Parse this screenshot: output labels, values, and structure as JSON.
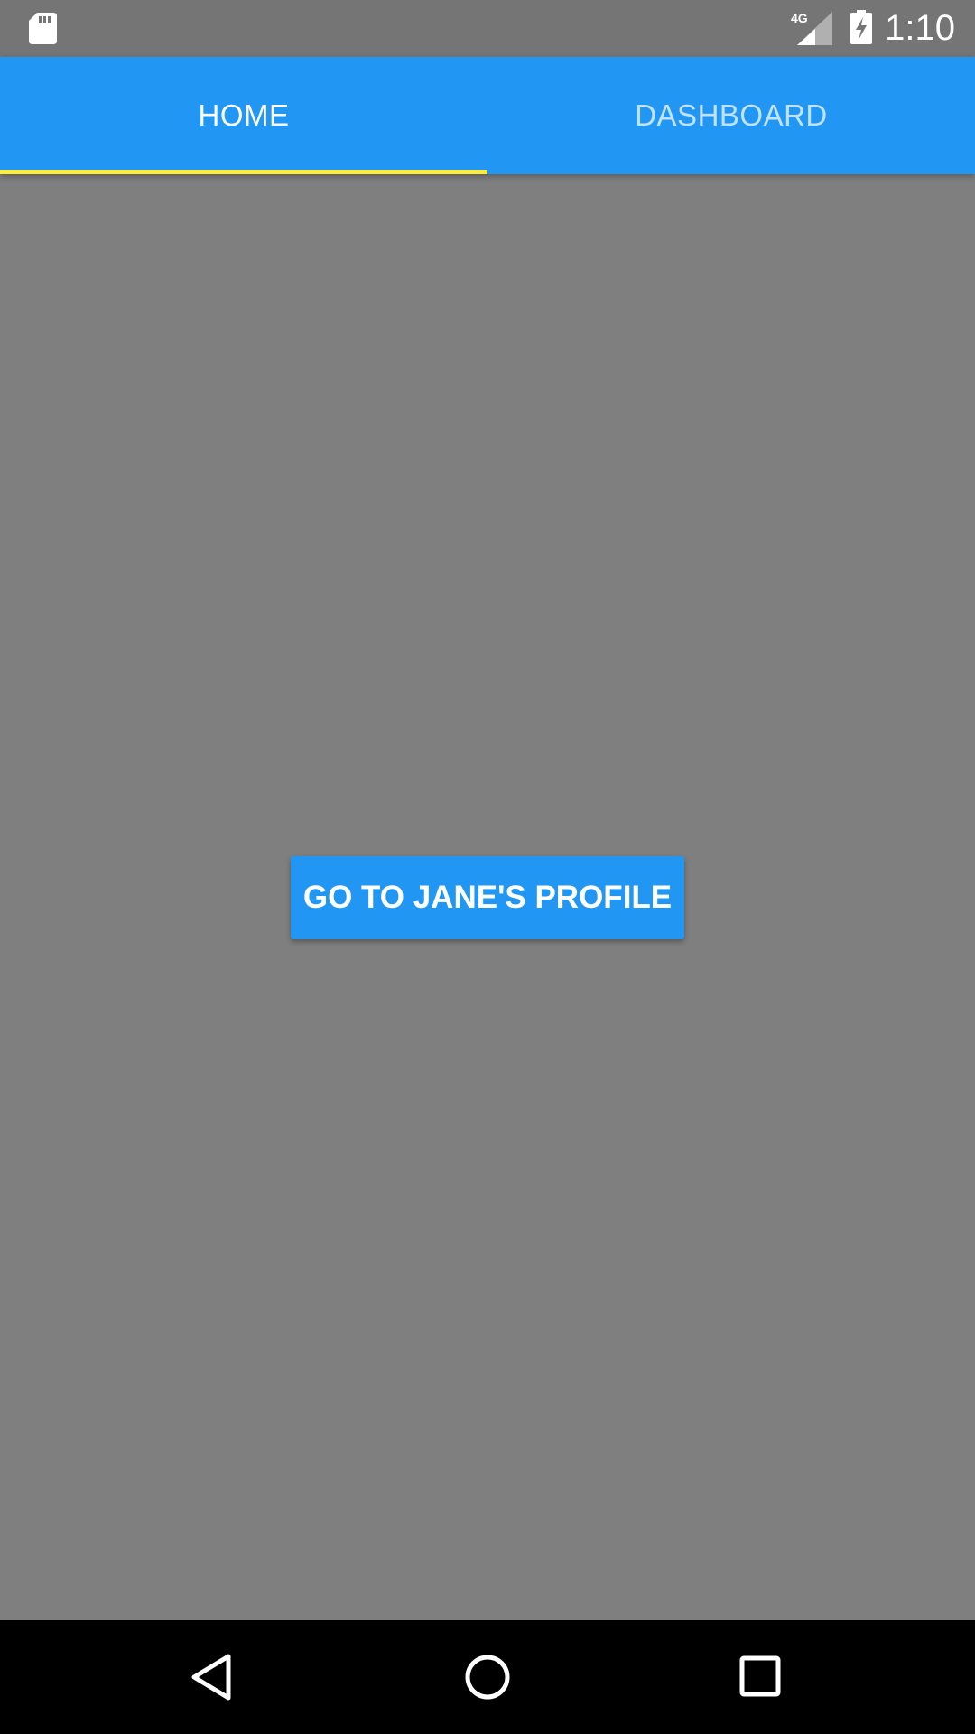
{
  "status_bar": {
    "network_label": "4G",
    "time": "1:10",
    "icons": [
      "sd-card-icon",
      "cellular-signal-icon",
      "battery-charging-icon"
    ]
  },
  "tabs": [
    {
      "label": "HOME",
      "selected": true
    },
    {
      "label": "DASHBOARD",
      "selected": false
    }
  ],
  "main": {
    "profile_button_label": "GO TO JANE'S PROFILE"
  },
  "nav_bar": {
    "icons": [
      "back-icon",
      "home-icon",
      "recents-icon"
    ]
  },
  "colors": {
    "primary": "#2196f3",
    "tab_indicator": "#ffeb3b",
    "content_background": "#7f7f7f",
    "status_bar": "#757575",
    "nav_bar": "#000000"
  }
}
